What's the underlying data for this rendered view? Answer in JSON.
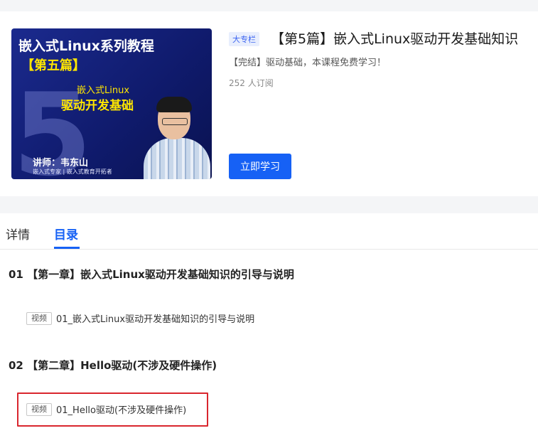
{
  "course": {
    "cover": {
      "big_number": "5",
      "title": "嵌入式Linux系列教程",
      "subtitle": "【第五篇】",
      "line1": "嵌入式Linux",
      "line2": "驱动开发基础",
      "teacher": "讲师：韦东山",
      "tagline": "嵌入式专家 | 嵌入式教育开拓者"
    },
    "badge": "大专栏",
    "title": "【第5篇】嵌入式Linux驱动开发基础知识",
    "description": "【完结】驱动基础，本课程免费学习！",
    "subscribers": "252 人订阅",
    "study_button": "立即学习"
  },
  "tabs": {
    "details": "详情",
    "catalog": "目录",
    "active": "catalog"
  },
  "chapters": [
    {
      "heading": "01 【第一章】嵌入式Linux驱动开发基础知识的引导与说明",
      "lesson": {
        "tag": "视频",
        "title": "01_嵌入式Linux驱动开发基础知识的引导与说明"
      }
    },
    {
      "heading": "02 【第二章】Hello驱动(不涉及硬件操作)",
      "lesson": {
        "tag": "视频",
        "title": "01_Hello驱动(不涉及硬件操作)"
      }
    }
  ],
  "colors": {
    "accent": "#1661f5",
    "highlight_border": "#d9262e",
    "cover_bg": "#1b2a8e",
    "cover_yellow": "#ffe600"
  }
}
